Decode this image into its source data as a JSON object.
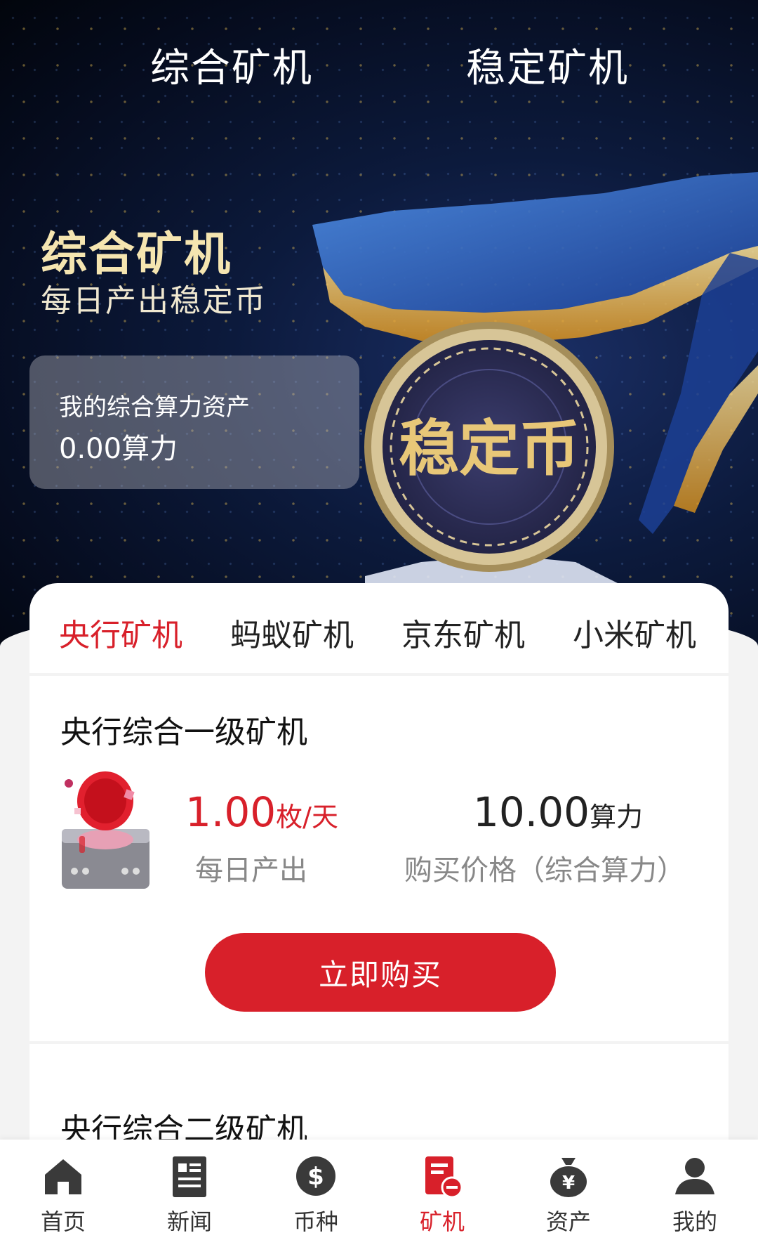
{
  "top_tabs": [
    "综合矿机",
    "稳定矿机"
  ],
  "hero": {
    "title": "综合矿机",
    "subtitle": "每日产出稳定币",
    "coin_text": "稳定币",
    "asset_label": "我的综合算力资产",
    "asset_value": "0.00算力"
  },
  "category_tabs": [
    "央行矿机",
    "蚂蚁矿机",
    "京东矿机",
    "小米矿机"
  ],
  "active_category": "央行矿机",
  "products": [
    {
      "title": "央行综合一级矿机",
      "daily_output_value": "1.00",
      "daily_output_unit": "枚/天",
      "daily_output_label": "每日产出",
      "price_value": "10.00",
      "price_unit": "算力",
      "price_label": "购买价格（综合算力）",
      "buy_label": "立即购买"
    },
    {
      "title": "央行综合二级矿机"
    }
  ],
  "bottom_nav": [
    {
      "label": "首页",
      "icon": "home-icon"
    },
    {
      "label": "新闻",
      "icon": "news-icon"
    },
    {
      "label": "币种",
      "icon": "dollar-coin-icon"
    },
    {
      "label": "矿机",
      "icon": "miner-icon"
    },
    {
      "label": "资产",
      "icon": "money-bag-icon"
    },
    {
      "label": "我的",
      "icon": "user-icon"
    }
  ],
  "active_nav": "矿机",
  "colors": {
    "accent": "#d8202a",
    "hero_bg": "#0c1a3c",
    "gold": "#f5c542"
  }
}
